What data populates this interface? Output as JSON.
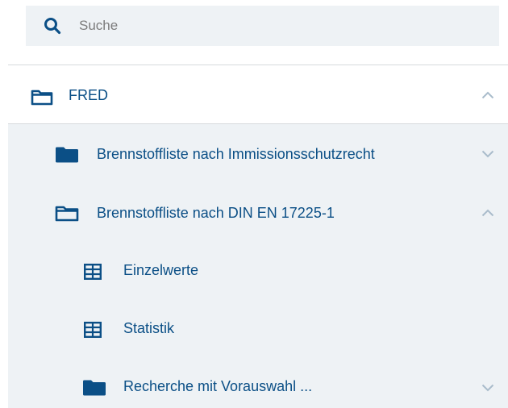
{
  "search": {
    "placeholder": "Suche",
    "value": ""
  },
  "tree": {
    "root": {
      "label": "FRED",
      "expanded": true,
      "icon": "folder-outline-icon"
    },
    "children": [
      {
        "label": "Brennstoffliste nach Immissionsschutzrecht",
        "icon": "folder-filled-icon",
        "expanded": false
      },
      {
        "label": "Brennstoffliste nach DIN EN 17225-1",
        "icon": "folder-outline-icon",
        "expanded": true
      },
      {
        "label": "Einzelwerte",
        "icon": "table-icon"
      },
      {
        "label": "Statistik",
        "icon": "table-icon"
      },
      {
        "label": "Recherche mit Vorauswahl ...",
        "icon": "folder-filled-icon",
        "expanded": false
      }
    ]
  },
  "colors": {
    "accent": "#0b4f86",
    "panel_bg": "#eef2f5",
    "chevron": "#a9bccb",
    "divider": "#d6dadd"
  }
}
